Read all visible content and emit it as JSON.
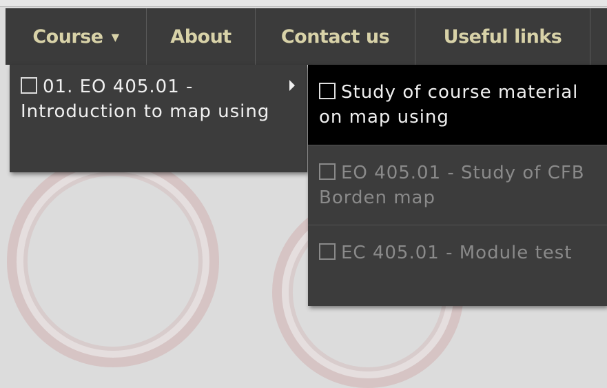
{
  "nav": {
    "course_label": "Course",
    "about_label": "About",
    "contact_label": "Contact us",
    "links_label": "Useful links"
  },
  "menu_level1": {
    "item1_label": "01. EO 405.01 - Introduction to map using"
  },
  "menu_level2": {
    "items": [
      {
        "label": "Study of course material on map using",
        "state": "active"
      },
      {
        "label": "EO 405.01 - Study of CFB Borden map",
        "state": "disabled"
      },
      {
        "label": "EC 405.01 - Module test",
        "state": "disabled"
      }
    ]
  },
  "colors": {
    "nav_background": "#3b3b3b",
    "nav_text": "#d8d2a8",
    "menu_background": "#3c3c3c",
    "active_item_background": "#000000",
    "disabled_text": "#8a8a8a"
  }
}
